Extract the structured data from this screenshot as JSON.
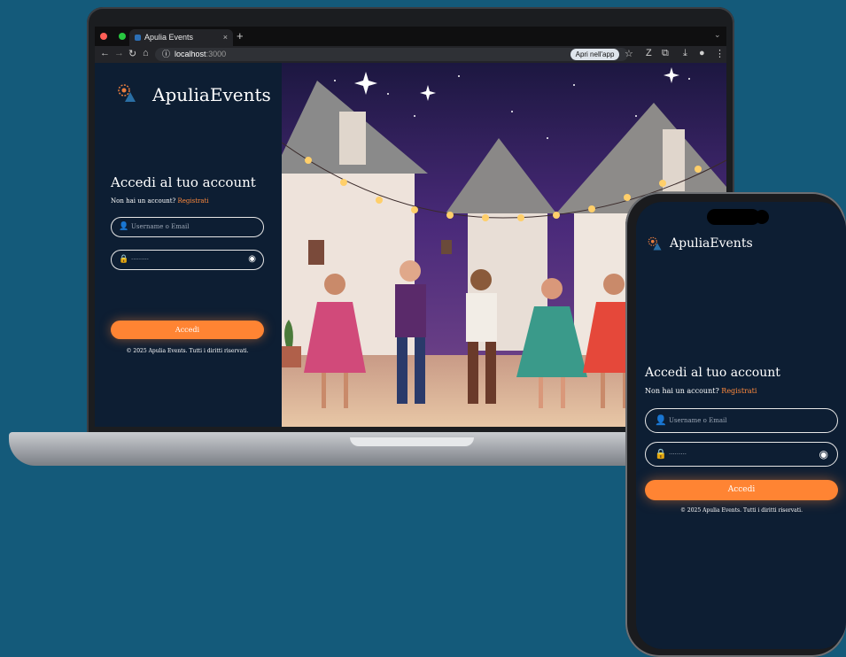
{
  "colors": {
    "background": "#145a7a",
    "panel": "#0d1e33",
    "accent": "#ff8433",
    "link": "#ff8a3d"
  },
  "browser": {
    "tab_title": "Apulia Events",
    "tab_close": "×",
    "new_tab": "+",
    "menu_chevron": "⌄",
    "url_host": "localhost",
    "url_port": ":3000",
    "open_in_app": "Apri nell'app"
  },
  "login": {
    "brand": "ApuliaEvents",
    "heading": "Accedi al tuo account",
    "no_account": "Non hai un account?",
    "register_link": "Registrati",
    "username_placeholder": "Username o Email",
    "password_value": "·········",
    "submit": "Accedi",
    "copyright": "© 2025 Apulia Events. Tutti i diritti riservati."
  },
  "icons": [
    "user-icon",
    "lock-icon",
    "eye-icon",
    "back-icon",
    "forward-icon",
    "reload-icon",
    "home-icon",
    "info-icon",
    "star-icon",
    "extensions-icon",
    "download-icon",
    "menu-icon"
  ]
}
